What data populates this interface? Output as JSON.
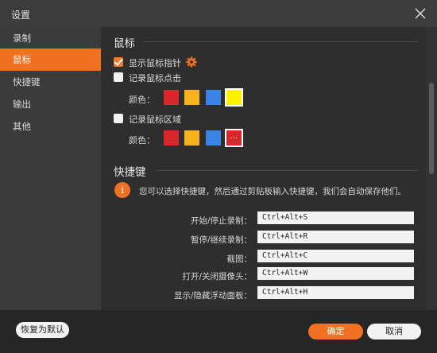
{
  "window": {
    "title": "设置"
  },
  "sidebar": {
    "items": [
      {
        "label": "录制",
        "active": false
      },
      {
        "label": "鼠标",
        "active": true
      },
      {
        "label": "快捷键",
        "active": false
      },
      {
        "label": "输出",
        "active": false
      },
      {
        "label": "其他",
        "active": false
      }
    ]
  },
  "mouse": {
    "section_title": "鼠标",
    "show_cursor": {
      "label": "显示鼠标指针",
      "checked": true
    },
    "record_clicks": {
      "label": "记录鼠标点击",
      "checked": false
    },
    "click_colors": {
      "label": "颜色：",
      "swatches": [
        "#d9262a",
        "#f8b21c",
        "#3a84e6",
        "#fff200"
      ],
      "selected_index": 3
    },
    "record_area": {
      "label": "记录鼠标区域",
      "checked": false
    },
    "area_colors": {
      "label": "颜色：",
      "swatches": [
        "#d9262a",
        "#f8b21c",
        "#3a84e6",
        "#d9262a"
      ],
      "custom_label": "...",
      "selected_index": 3
    }
  },
  "hotkeys": {
    "section_title": "快捷键",
    "info": "您可以选择快捷键，然后通过剪贴板输入快捷键，我们会自动保存他们。",
    "rows": [
      {
        "label": "开始/停止录制：",
        "value": "Ctrl+Alt+S"
      },
      {
        "label": "暂停/继续录制：",
        "value": "Ctrl+Alt+R"
      },
      {
        "label": "截图：",
        "value": "Ctrl+Alt+C"
      },
      {
        "label": "打开/关闭摄像头：",
        "value": "Ctrl+Alt+W"
      },
      {
        "label": "显示/隐藏浮动面板：",
        "value": "Ctrl+Alt+H"
      }
    ]
  },
  "footer": {
    "restore_label": "恢复为默认",
    "ok_label": "确定",
    "cancel_label": "取消"
  },
  "colors": {
    "accent": "#f07122",
    "background": "#2e2e2e",
    "sidebar": "#3b3b3b"
  }
}
